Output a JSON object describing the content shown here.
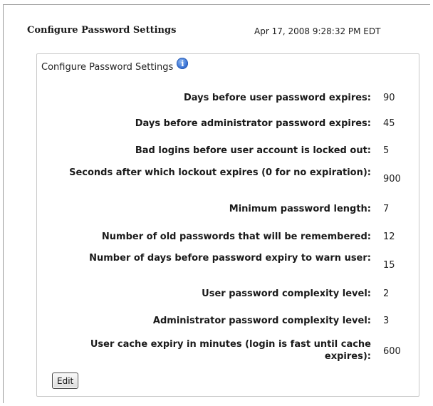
{
  "header": {
    "title": "Configure Password Settings",
    "timestamp": "Apr 17, 2008 9:28:32 PM EDT"
  },
  "panel": {
    "title": "Configure Password Settings",
    "info_icon": "info-icon",
    "rows": [
      {
        "label": "Days before user password expires:",
        "value": "90"
      },
      {
        "label": "Days before administrator password expires:",
        "value": "45"
      },
      {
        "label": "Bad logins before user account is locked out:",
        "value": "5"
      },
      {
        "label": "Seconds after which lockout expires (0 for no expiration):",
        "value": "900"
      },
      {
        "label": "Minimum password length:",
        "value": "7"
      },
      {
        "label": "Number of old passwords that will be remembered:",
        "value": "12"
      },
      {
        "label": "Number of days before password expiry to warn user:",
        "value": "15"
      },
      {
        "label": "User password complexity level:",
        "value": "2"
      },
      {
        "label": "Administrator password complexity level:",
        "value": "3"
      },
      {
        "label": "User cache expiry in minutes (login is fast until cache expires):",
        "value": "600"
      }
    ],
    "edit_label": "Edit"
  }
}
